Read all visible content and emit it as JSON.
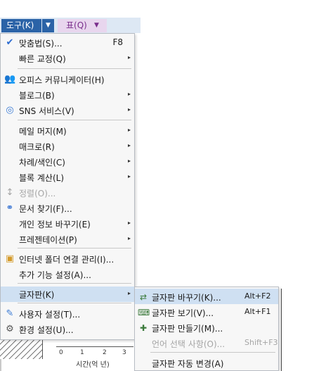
{
  "menubar": {
    "tools": "도구(K)",
    "table": "표(Q)"
  },
  "tools_menu": [
    {
      "id": "spell",
      "label": "맞춤법(S)...",
      "shortcut": "F8",
      "icon": "spellcheck-icon",
      "glyph": "✔",
      "color": "#2a6ad0"
    },
    {
      "id": "quick",
      "label": "빠른 교정(Q)",
      "arrow": "▸"
    },
    {
      "id": "communicator",
      "label": "오피스 커뮤니케이터(H)",
      "icon": "communicator-icon",
      "glyph": "👥",
      "color": "#3a7bd5"
    },
    {
      "id": "blog",
      "label": "블로그(B)",
      "arrow": "▸"
    },
    {
      "id": "sns",
      "label": "SNS 서비스(V)",
      "arrow": "▸",
      "icon": "sns-icon",
      "glyph": "◎",
      "color": "#3a7bd5"
    },
    {
      "id": "mailmerge",
      "label": "메일 머지(M)",
      "arrow": "▸"
    },
    {
      "id": "macro",
      "label": "매크로(R)",
      "arrow": "▸"
    },
    {
      "id": "toc",
      "label": "차례/색인(C)",
      "arrow": "▸"
    },
    {
      "id": "blockcalc",
      "label": "블록 계산(L)",
      "arrow": "▸"
    },
    {
      "id": "sort",
      "label": "정렬(O)...",
      "disabled": true,
      "icon": "sort-icon",
      "glyph": "↕"
    },
    {
      "id": "finddoc",
      "label": "문서 찾기(F)...",
      "icon": "binoculars-icon",
      "glyph": "⚭",
      "color": "#2a6ad0"
    },
    {
      "id": "privacy",
      "label": "개인 정보 바꾸기(E)",
      "arrow": "▸"
    },
    {
      "id": "presentation",
      "label": "프레젠테이션(P)",
      "arrow": "▸"
    },
    {
      "id": "netfolder",
      "label": "인터넷 폴더 연결 관리(I)...",
      "icon": "network-folder-icon",
      "glyph": "▣",
      "color": "#d49a2a"
    },
    {
      "id": "addon",
      "label": "추가 기능 설정(A)..."
    },
    {
      "id": "keyboard",
      "label": "글자판(K)",
      "arrow": "▸",
      "highlight": true
    },
    {
      "id": "usersettings",
      "label": "사용자 설정(T)...",
      "icon": "user-settings-icon",
      "glyph": "✎",
      "color": "#3a7bd5"
    },
    {
      "id": "envsettings",
      "label": "환경 설정(U)...",
      "icon": "gear-icon",
      "glyph": "⚙",
      "color": "#555555"
    }
  ],
  "keyboard_submenu": [
    {
      "id": "switch",
      "label": "글자판 바꾸기(K)...",
      "shortcut": "Alt+F2",
      "icon": "keyboard-switch-icon",
      "glyph": "⇄",
      "highlight": true
    },
    {
      "id": "view",
      "label": "글자판 보기(V)...",
      "shortcut": "Alt+F1",
      "icon": "keyboard-icon",
      "glyph": "⌨"
    },
    {
      "id": "create",
      "label": "글자판 만들기(M)...",
      "icon": "keyboard-create-icon",
      "glyph": "✚"
    },
    {
      "id": "lang",
      "label": "언어 선택 사항(O)...",
      "shortcut": "Shift+F3",
      "disabled": true
    },
    {
      "id": "auto",
      "label": "글자판 자동 변경(A)"
    }
  ],
  "background": {
    "ticks": [
      "0",
      "1",
      "2",
      "3"
    ],
    "xaxis_label": "시간(억 년)"
  },
  "colors": {
    "accent": "#2b63a7",
    "highlight": "#cfe0f2",
    "table_tab": "#e8d6ee"
  }
}
